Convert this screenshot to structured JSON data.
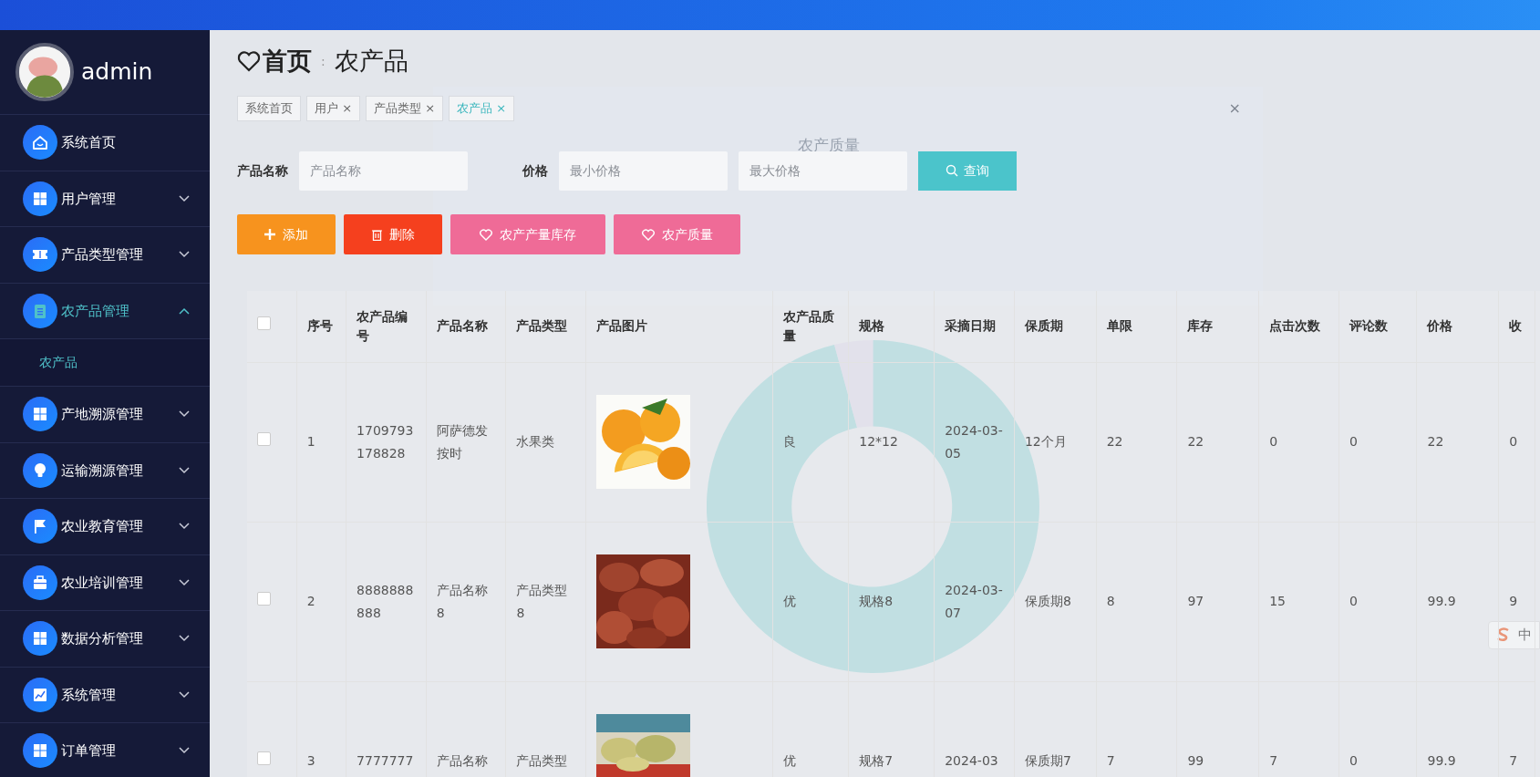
{
  "sidebar": {
    "user": "admin",
    "items": [
      {
        "label": "系统首页",
        "expanded": false,
        "kind": "link"
      },
      {
        "label": "用户管理",
        "expanded": false,
        "kind": "group"
      },
      {
        "label": "产品类型管理",
        "expanded": false,
        "kind": "group"
      },
      {
        "label": "农产品管理",
        "expanded": true,
        "kind": "group",
        "children": [
          {
            "label": "农产品"
          }
        ]
      },
      {
        "label": "产地溯源管理",
        "expanded": false,
        "kind": "group"
      },
      {
        "label": "运输溯源管理",
        "expanded": false,
        "kind": "group"
      },
      {
        "label": "农业教育管理",
        "expanded": false,
        "kind": "group"
      },
      {
        "label": "农业培训管理",
        "expanded": false,
        "kind": "group"
      },
      {
        "label": "数据分析管理",
        "expanded": false,
        "kind": "group"
      },
      {
        "label": "系统管理",
        "expanded": false,
        "kind": "group"
      },
      {
        "label": "订单管理",
        "expanded": false,
        "kind": "group"
      }
    ]
  },
  "breadcrumb": {
    "home": "首页",
    "separator": ":",
    "current": "农产品"
  },
  "tabs": [
    {
      "label": "系统首页",
      "closable": false,
      "selected": false
    },
    {
      "label": "用户",
      "closable": true,
      "selected": false
    },
    {
      "label": "产品类型",
      "closable": true,
      "selected": false
    },
    {
      "label": "农产品",
      "closable": true,
      "selected": true
    }
  ],
  "close_mark": "×",
  "filters": {
    "name_label": "产品名称",
    "name_placeholder": "产品名称",
    "price_label": "价格",
    "min_placeholder": "最小价格",
    "max_placeholder": "最大价格",
    "search_button": "查询"
  },
  "actions": [
    {
      "kind": "add",
      "label": "添加"
    },
    {
      "kind": "delete",
      "label": "删除"
    },
    {
      "kind": "stock",
      "label": "农产产量库存"
    },
    {
      "kind": "quality",
      "label": "农产质量"
    }
  ],
  "modal": {
    "title": "农产质量",
    "close": "×"
  },
  "table": {
    "all_checked": false,
    "columns": [
      "序号",
      "农产品编号",
      "产品名称",
      "产品类型",
      "产品图片",
      "农产品质量",
      "规格",
      "采摘日期",
      "保质期",
      "单限",
      "库存",
      "点击次数",
      "评论数",
      "价格",
      "收"
    ],
    "rows": [
      {
        "checked": false,
        "cells": [
          "1",
          "1709793178828",
          "阿萨德发按时",
          "水果类",
          "",
          "良",
          "12*12",
          "2024-03-05",
          "12个月",
          "22",
          "22",
          "0",
          "0",
          "22",
          "0"
        ]
      },
      {
        "checked": false,
        "cells": [
          "2",
          "8888888888",
          "产品名称8",
          "产品类型8",
          "",
          "优",
          "规格8",
          "2024-03-07",
          "保质期8",
          "8",
          "97",
          "15",
          "0",
          "99.9",
          "9"
        ]
      },
      {
        "checked": false,
        "cells": [
          "3",
          "7777777",
          "产品名称",
          "产品类型",
          "",
          "优",
          "规格7",
          "2024-03",
          "保质期7",
          "7",
          "99",
          "7",
          "0",
          "99.9",
          "7"
        ]
      }
    ]
  },
  "ime": {
    "label": "中"
  }
}
